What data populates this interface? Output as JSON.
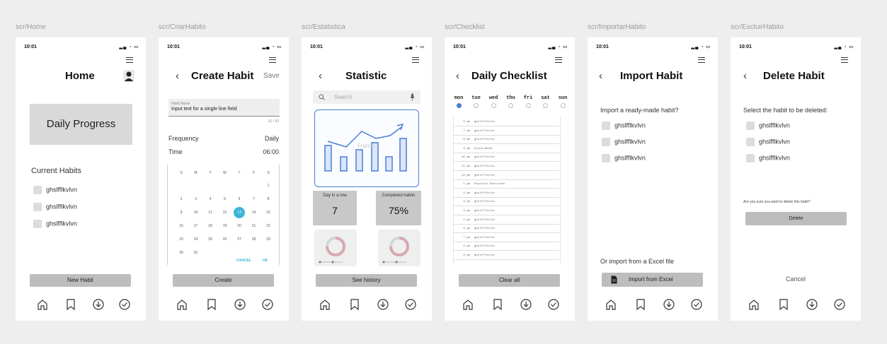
{
  "screens": [
    {
      "label": "scr/Home",
      "time": "10:01",
      "title": "Home",
      "progress_label": "Daily Progress",
      "section": "Current Habits",
      "habits": [
        "ghslfflkvlvn",
        "ghslfflkvlvn",
        "ghslfflkvlvn"
      ],
      "button": "New Habit"
    },
    {
      "label": "scr/CriarHabito",
      "time": "10:01",
      "title": "Create Habit",
      "save": "Save",
      "field_label": "Habit Name",
      "field_value": "Input text for a single line field",
      "counter": "31 / 50",
      "frequency_label": "Frequency",
      "frequency_value": "Daily",
      "time_label": "Time",
      "time_value": "06:00",
      "weekdays": [
        "S",
        "M",
        "T",
        "W",
        "T",
        "F",
        "S"
      ],
      "calendar_rows": [
        [
          "",
          "",
          "",
          "",
          "",
          "",
          "1"
        ],
        [
          "2",
          "3",
          "4",
          "5",
          "6",
          "7",
          "8"
        ],
        [
          "9",
          "10",
          "11",
          "12",
          "13",
          "14",
          "15"
        ],
        [
          "16",
          "17",
          "18",
          "19",
          "20",
          "21",
          "22"
        ],
        [
          "23",
          "24",
          "25",
          "26",
          "27",
          "28",
          "29"
        ],
        [
          "30",
          "31",
          "",
          "",
          "",
          "",
          ""
        ]
      ],
      "selected_day": "13",
      "cancel": "CANCEL",
      "ok": "OK",
      "button": "Create"
    },
    {
      "label": "scr/Estatistica",
      "time": "10:01",
      "title": "Statistic",
      "search_placeholder": "Search",
      "chart_watermark": "Frame ...",
      "stat1_label": "Day in a row",
      "stat1_value": "7",
      "stat2_label": "Completed habits",
      "stat2_value": "75%",
      "button": "See history"
    },
    {
      "label": "scr/Checklist",
      "time": "10:01",
      "title": "Daily Checklist",
      "days": [
        "mon",
        "tue",
        "wed",
        "thu",
        "fri",
        "sat",
        "sun"
      ],
      "rows": [
        {
          "t": "6 am",
          "n": "ghslfflkvlvn"
        },
        {
          "t": "7 am",
          "n": "ghslfflkvlvn"
        },
        {
          "t": "8 am",
          "n": "ghslfflkvlvn"
        },
        {
          "t": "9 am",
          "n": "Drink Water"
        },
        {
          "t": "10 am",
          "n": "ghslfflkvlvn"
        },
        {
          "t": "11 am",
          "n": "ghslfflkvlvn"
        },
        {
          "t": "12 pm",
          "n": "ghslfflkvlvn"
        },
        {
          "t": "1 pm",
          "n": "Physical Exercises"
        },
        {
          "t": "2 pm",
          "n": "ghslfflkvlvn"
        },
        {
          "t": "3 pm",
          "n": "ghslfflkvlvn"
        },
        {
          "t": "4 pm",
          "n": "ghslfflkvlvn"
        },
        {
          "t": "5 pm",
          "n": "ghslfflkvlvn"
        },
        {
          "t": "6 pm",
          "n": "ghslfflkvlvn"
        },
        {
          "t": "7 pm",
          "n": "ghslfflkvlvn"
        },
        {
          "t": "8 pm",
          "n": "ghslfflkvlvn"
        },
        {
          "t": "9 pm",
          "n": "ghslfflkvlvn"
        }
      ],
      "button": "Clear all"
    },
    {
      "label": "scr/ImportarHabito",
      "time": "10:01",
      "title": "Import Habit",
      "prompt": "Import a ready-made habit?",
      "habits": [
        "ghslfflkvlvn",
        "ghslfflkvlvn",
        "ghslfflkvlvn"
      ],
      "excel_prompt": "Or import from a Excel file",
      "button": "Import from Excel"
    },
    {
      "label": "scr/ExcluirHabito",
      "time": "10:01",
      "title": "Delete Habit",
      "prompt": "Select the habit to be deleted:",
      "habits": [
        "ghslfflkvlvn",
        "ghslfflkvlvn",
        "ghslfflkvlvn"
      ],
      "confirm": "Are you sure you want to delete this habit?",
      "delete": "Delete",
      "cancel": "Cancel"
    }
  ],
  "colors": {
    "accent": "#4a7cd6",
    "selected_day": "#3db4d6",
    "button_gray": "#bdbdbd"
  },
  "icons": [
    "home-icon",
    "bookmark-icon",
    "download-icon",
    "check-circle-icon"
  ]
}
